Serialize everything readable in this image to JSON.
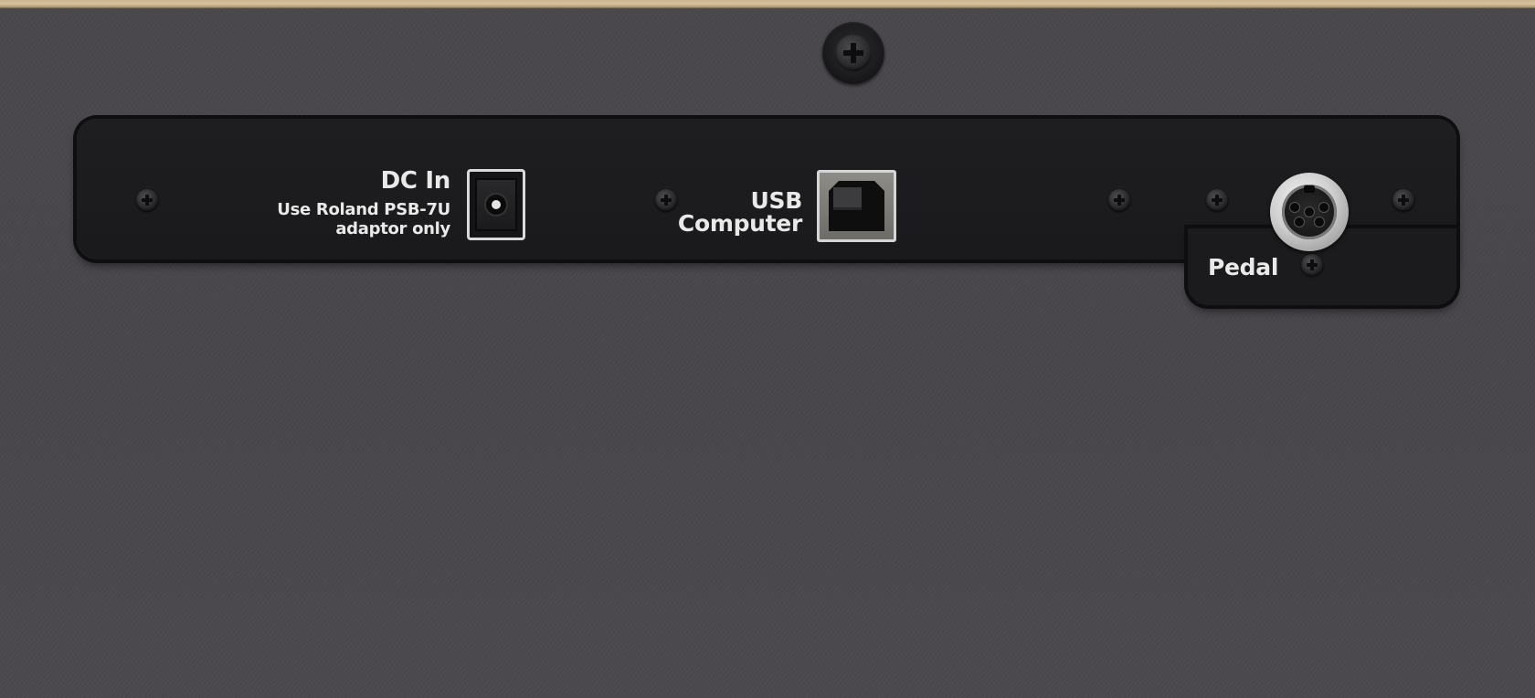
{
  "panel": {
    "dc_in": {
      "title": "DC In",
      "note_line1": "Use Roland PSB-7U",
      "note_line2": "adaptor only"
    },
    "usb": {
      "title": "USB",
      "subtitle": "Computer"
    },
    "pedal": {
      "title": "Pedal"
    }
  },
  "colors": {
    "background": "#4a474c",
    "plate": "#1c1c1e",
    "label_text": "#e9e9ea",
    "wood_edge": "#d8c39c"
  },
  "icons": {
    "top_screw": "phillips-screw-icon",
    "plate_screw": "plate-screw-icon",
    "dc_jack": "dc-power-jack-icon",
    "usb_port": "usb-b-port-icon",
    "pedal_jack": "din-connector-icon"
  }
}
